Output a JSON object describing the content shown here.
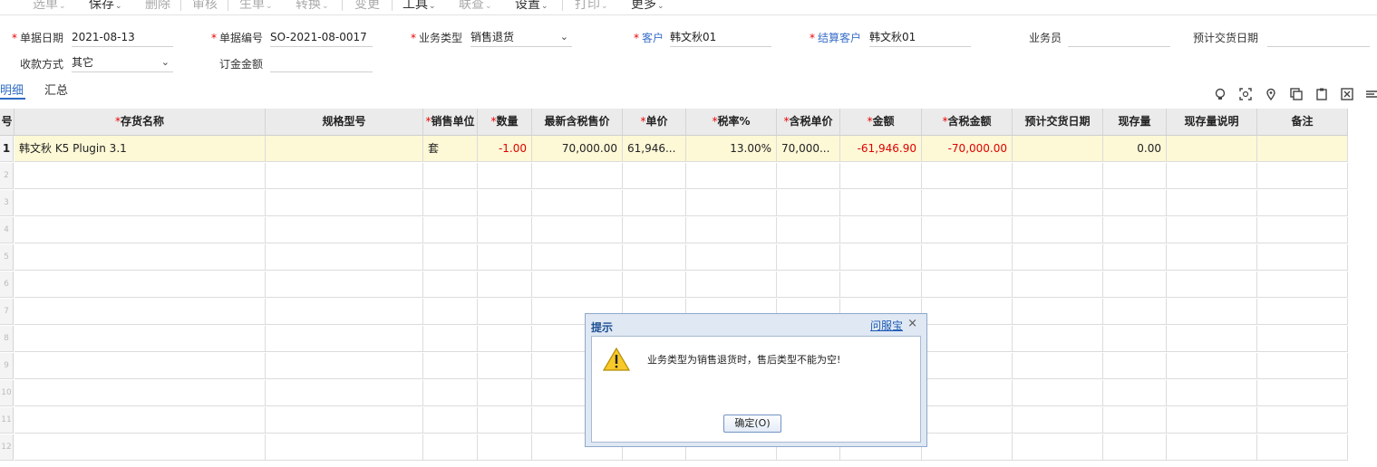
{
  "toolbar": {
    "items": [
      {
        "label": "选单",
        "chevron": true,
        "disabled": true
      },
      {
        "label": "保存",
        "chevron": true,
        "disabled": false
      },
      {
        "label": "删除",
        "chevron": false,
        "disabled": true
      },
      {
        "label": "审核",
        "chevron": false,
        "disabled": true
      },
      {
        "label": "生单",
        "chevron": true,
        "disabled": true
      },
      {
        "label": "转换",
        "chevron": true,
        "disabled": true
      },
      {
        "label": "变更",
        "chevron": false,
        "disabled": true
      },
      {
        "label": "工具",
        "chevron": true,
        "disabled": false
      },
      {
        "label": "联查",
        "chevron": true,
        "disabled": true
      },
      {
        "label": "设置",
        "chevron": true,
        "disabled": false
      },
      {
        "label": "打印",
        "chevron": true,
        "disabled": true
      },
      {
        "label": "更多",
        "chevron": true,
        "disabled": false
      }
    ]
  },
  "form": {
    "doc_date": {
      "label": "单据日期",
      "value": "2021-08-13"
    },
    "doc_no": {
      "label": "单据编号",
      "value": "SO-2021-08-0017"
    },
    "biz_type": {
      "label": "业务类型",
      "value": "销售退货"
    },
    "customer": {
      "label": "客户",
      "value": "韩文秋01"
    },
    "settle_customer": {
      "label": "结算客户",
      "value": "韩文秋01"
    },
    "salesman": {
      "label": "业务员",
      "value": ""
    },
    "delivery_date": {
      "label": "预计交货日期",
      "value": ""
    },
    "payment_method": {
      "label": "收款方式",
      "value": "其它"
    },
    "deposit": {
      "label": "订金金额",
      "value": ""
    }
  },
  "tabs": {
    "detail": "明细",
    "summary": "汇总"
  },
  "table_icons": [
    "bulb-icon",
    "scan-icon",
    "location-icon",
    "copy-row-icon",
    "paste-icon",
    "delete-row-icon",
    "more-icon"
  ],
  "grid": {
    "columns": [
      {
        "label": "号",
        "required": false
      },
      {
        "label": "存货名称",
        "required": true
      },
      {
        "label": "规格型号",
        "required": false
      },
      {
        "label": "销售单位",
        "required": true
      },
      {
        "label": "数量",
        "required": true
      },
      {
        "label": "最新含税售价",
        "required": false
      },
      {
        "label": "单价",
        "required": true
      },
      {
        "label": "税率%",
        "required": true
      },
      {
        "label": "含税单价",
        "required": true
      },
      {
        "label": "金额",
        "required": true
      },
      {
        "label": "含税金额",
        "required": true
      },
      {
        "label": "预计交货日期",
        "required": false
      },
      {
        "label": "现存量",
        "required": false
      },
      {
        "label": "现存量说明",
        "required": false
      },
      {
        "label": "备注",
        "required": false
      }
    ],
    "rows": [
      {
        "index": "1",
        "cells": [
          "韩文秋  K5 Plugin 3.1",
          "",
          "套",
          "-1.00",
          "70,000.00",
          "61,946...",
          "13.00%",
          "70,000...",
          "-61,946.90",
          "-70,000.00",
          "",
          "0.00",
          "",
          ""
        ]
      }
    ],
    "empty_row_numbers": [
      "2",
      "3",
      "4",
      "5",
      "6",
      "7",
      "8",
      "9",
      "10",
      "11",
      "12"
    ]
  },
  "dialog": {
    "title": "提示",
    "help_link": "问服宝",
    "close": "×",
    "message": "业务类型为销售退货时，售后类型不能为空!",
    "ok_button": "确定(O)"
  }
}
